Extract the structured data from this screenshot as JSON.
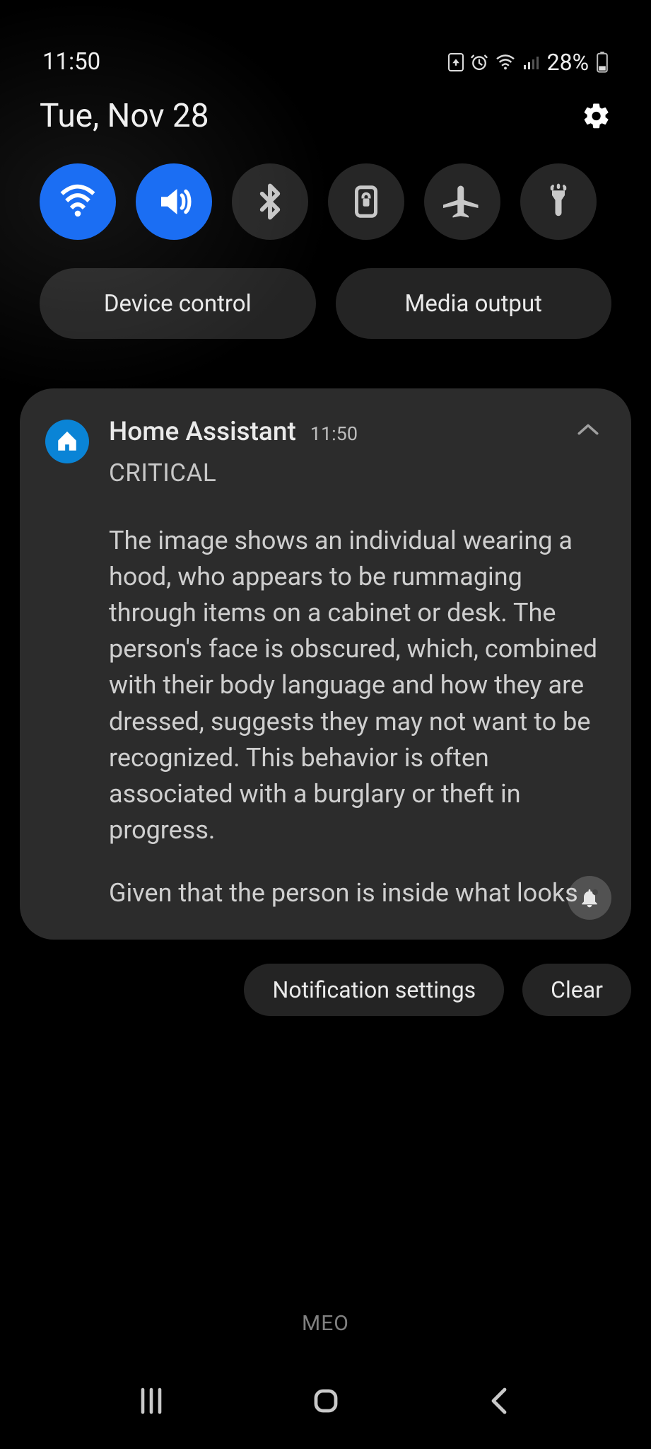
{
  "status": {
    "time": "11:50",
    "battery_percent": "28%"
  },
  "date": "Tue, Nov 28",
  "quick_settings": {
    "toggles": [
      {
        "name": "wifi-toggle",
        "icon": "wifi-icon",
        "active": true
      },
      {
        "name": "sound-toggle",
        "icon": "sound-icon",
        "active": true
      },
      {
        "name": "bluetooth-toggle",
        "icon": "bluetooth-icon",
        "active": false
      },
      {
        "name": "rotation-lock-toggle",
        "icon": "rotation-lock-icon",
        "active": false
      },
      {
        "name": "airplane-toggle",
        "icon": "airplane-icon",
        "active": false
      },
      {
        "name": "flashlight-toggle",
        "icon": "flashlight-icon",
        "active": false
      }
    ],
    "pills": {
      "device_control": "Device control",
      "media_output": "Media output"
    }
  },
  "notification": {
    "app_name": "Home Assistant",
    "time": "11:50",
    "subtitle": "CRITICAL",
    "body1": "The image shows an individual wearing a hood, who appears to be rummaging through items on a cabinet or desk. The person's face is obscured, which, combined with their body language and how they are dressed, suggests they may not want to be recognized. This behavior is often associated with a burglary or theft in progress.",
    "body2": "Given that the person is inside what looks"
  },
  "actions": {
    "notification_settings": "Notification settings",
    "clear": "Clear"
  },
  "carrier": "MEO"
}
